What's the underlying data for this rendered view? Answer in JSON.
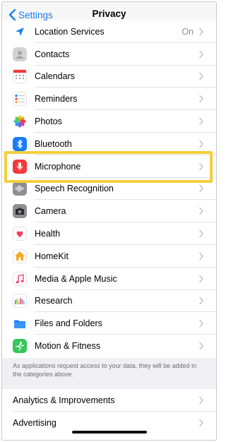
{
  "navbar": {
    "back_label": "Settings",
    "title": "Privacy"
  },
  "items": [
    {
      "label": "Location Services",
      "value": "On",
      "icon": "location-arrow-icon",
      "color": "#1a7cf5"
    },
    {
      "label": "Contacts",
      "icon": "contacts-icon",
      "color": "#c8c8cc"
    },
    {
      "label": "Calendars",
      "icon": "calendar-icon",
      "color": "#ffffff"
    },
    {
      "label": "Reminders",
      "icon": "reminders-icon",
      "color": "#ffffff"
    },
    {
      "label": "Photos",
      "icon": "photos-icon",
      "color": "#ffffff"
    },
    {
      "label": "Bluetooth",
      "icon": "bluetooth-icon",
      "color": "#1a7cf5"
    },
    {
      "label": "Microphone",
      "icon": "microphone-icon",
      "color": "#f2393b"
    },
    {
      "label": "Speech Recognition",
      "icon": "waveform-icon",
      "color": "#8e8e93"
    },
    {
      "label": "Camera",
      "icon": "camera-icon",
      "color": "#8e8e93"
    },
    {
      "label": "Health",
      "icon": "heart-icon",
      "color": "#ffffff"
    },
    {
      "label": "HomeKit",
      "icon": "home-icon",
      "color": "#f7a827"
    },
    {
      "label": "Media & Apple Music",
      "icon": "music-note-icon",
      "color": "#fb3c63"
    },
    {
      "label": "Research",
      "icon": "research-icon",
      "color": "#ffffff"
    },
    {
      "label": "Files and Folders",
      "icon": "folder-icon",
      "color": "#1a7cf5"
    },
    {
      "label": "Motion & Fitness",
      "icon": "fitness-icon",
      "color": "#34c759"
    }
  ],
  "footer_note": "As applications request access to your data, they will be added in the categories above.",
  "group2": [
    {
      "label": "Analytics & Improvements"
    },
    {
      "label": "Advertising"
    }
  ]
}
